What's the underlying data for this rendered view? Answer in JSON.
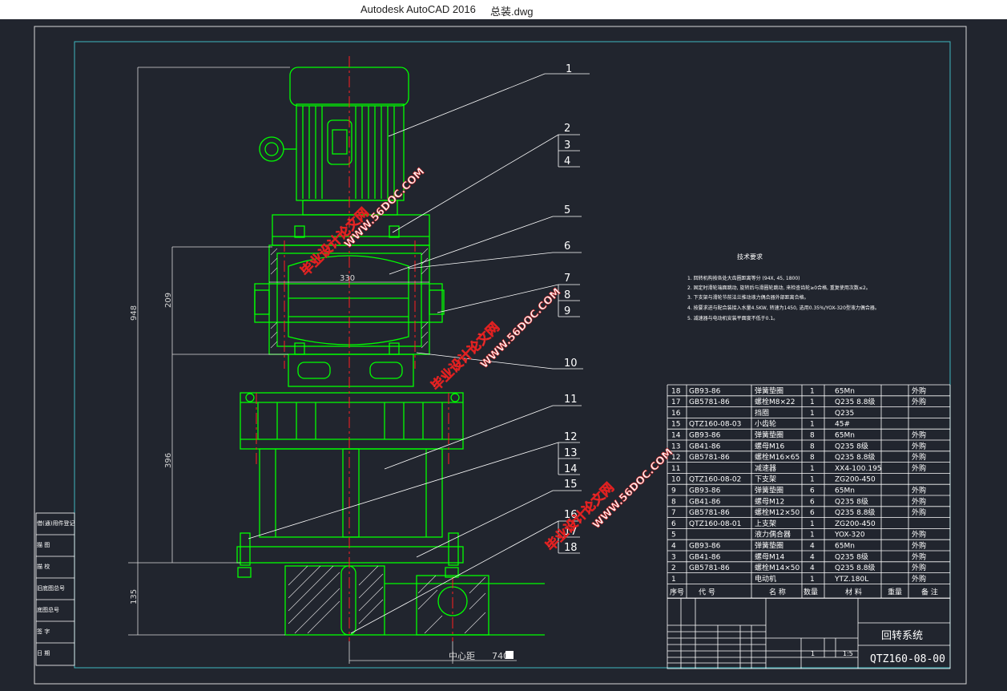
{
  "window": {
    "app": "Autodesk AutoCAD 2016",
    "file": "总装.dwg"
  },
  "callouts": [
    "1",
    "2",
    "3",
    "4",
    "5",
    "6",
    "7",
    "8",
    "9",
    "10",
    "11",
    "12",
    "13",
    "14",
    "15",
    "16",
    "17",
    "18"
  ],
  "dimensions": {
    "d948": "948",
    "d209": "209",
    "d396": "396",
    "d135": "135",
    "d330": "330",
    "center_label": "中心距",
    "center_value": "740"
  },
  "tech_req": {
    "title": "技术要求",
    "lines": [
      "1. 回转机构按各处大齿圈距离等分 (94X, 45, 1800)",
      "2. 固定时滑轮端面跳动, 旋转后与滑圈轮跳动, 来检查齿轮≥0合格, 重复使用次数≤2。",
      "3. 下支架与滑轮节前法兰推动液力偶合器外部距离合格。",
      "4. 按要求进与配合装接入水量4.5KW, 转速为1450, 选用0.35%/YOX-320型液力偶合器。",
      "5. 减速器与电动机安装平面度不低于0.1。"
    ]
  },
  "bom": {
    "rows": [
      [
        "18",
        "GB93-86",
        "弹簧垫圈",
        "1",
        "65Mn",
        "外购"
      ],
      [
        "17",
        "GB5781-86",
        "螺栓M8×22",
        "1",
        "Q235  8.8级",
        "外购"
      ],
      [
        "16",
        "",
        "挡圈",
        "1",
        "Q235",
        ""
      ],
      [
        "15",
        "QTZ160-08-03",
        "小齿轮",
        "1",
        "45#",
        ""
      ],
      [
        "14",
        "GB93-86",
        "弹簧垫圈",
        "8",
        "65Mn",
        "外购"
      ],
      [
        "13",
        "GB41-86",
        "螺母M16",
        "8",
        "Q235  8级",
        "外购"
      ],
      [
        "12",
        "GB5781-86",
        "螺栓M16×65",
        "8",
        "Q235  8.8级",
        "外购"
      ],
      [
        "11",
        "",
        "减速器",
        "1",
        "XX4-100.195",
        "外购"
      ],
      [
        "10",
        "QTZ160-08-02",
        "下支架",
        "1",
        "ZG200-450",
        ""
      ],
      [
        "9",
        "GB93-86",
        "弹簧垫圈",
        "6",
        "65Mn",
        "外购"
      ],
      [
        "8",
        "GB41-86",
        "螺母M12",
        "6",
        "Q235  8级",
        "外购"
      ],
      [
        "7",
        "GB5781-86",
        "螺栓M12×50",
        "6",
        "Q235  8.8级",
        "外购"
      ],
      [
        "6",
        "QTZ160-08-01",
        "上支架",
        "1",
        "ZG200-450",
        ""
      ],
      [
        "5",
        "",
        "液力偶合器",
        "1",
        "YOX-320",
        "外购"
      ],
      [
        "4",
        "GB93-86",
        "弹簧垫圈",
        "4",
        "65Mn",
        "外购"
      ],
      [
        "3",
        "GB41-86",
        "螺母M14",
        "4",
        "Q235  8级",
        "外购"
      ],
      [
        "2",
        "GB5781-86",
        "螺栓M14×50",
        "4",
        "Q235  8.8级",
        "外购"
      ],
      [
        "1",
        "",
        "电动机",
        "1",
        "YTZ.180L",
        "外购"
      ]
    ],
    "header": [
      "序号",
      "代  号",
      "名  称",
      "数量",
      "材  料",
      "重量",
      "备 注"
    ]
  },
  "title_block": {
    "name": "回转系统",
    "code": "QTZ160-08-00",
    "scale": "1:5",
    "qty": "1"
  },
  "left_block": [
    "借(通)用件登记",
    "描  图",
    "描  校",
    "旧底图总号",
    "底图总号",
    "签  字",
    "日  期"
  ],
  "watermark": [
    "毕业设计论文网",
    "WWW.56DOC.COM"
  ],
  "colors": {
    "background": "#21252e",
    "outline": "#00ff00",
    "frame": "#ffffff",
    "center": "#ff2020",
    "border": "#3fb8c0"
  }
}
